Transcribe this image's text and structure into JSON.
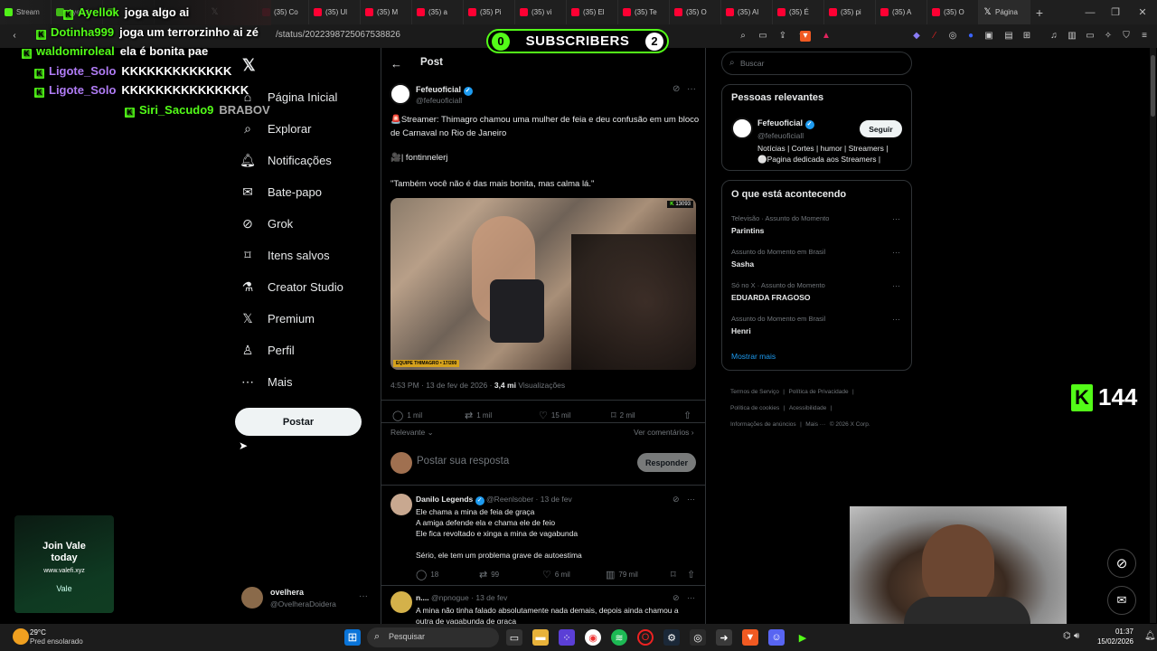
{
  "browser": {
    "tabs": [
      {
        "label": "Stream",
        "kind": "kick"
      },
      {
        "label": "Ayellok",
        "kind": "kick"
      },
      {
        "label": "",
        "kind": "kick"
      },
      {
        "label": "",
        "kind": "x"
      },
      {
        "label": "",
        "kind": "x"
      },
      {
        "label": "(35) Co",
        "kind": "yt"
      },
      {
        "label": "(35) Ul",
        "kind": "yt"
      },
      {
        "label": "(35) M",
        "kind": "yt"
      },
      {
        "label": "(35) a",
        "kind": "yt"
      },
      {
        "label": "(35) Pi",
        "kind": "yt"
      },
      {
        "label": "(35) vi",
        "kind": "yt"
      },
      {
        "label": "(35) El",
        "kind": "yt"
      },
      {
        "label": "(35) Te",
        "kind": "yt"
      },
      {
        "label": "(35) O",
        "kind": "yt"
      },
      {
        "label": "(35) Al",
        "kind": "yt"
      },
      {
        "label": "(35) É",
        "kind": "yt"
      },
      {
        "label": "(35) pi",
        "kind": "yt"
      },
      {
        "label": "(35) A",
        "kind": "yt"
      },
      {
        "label": "(35) O",
        "kind": "yt"
      },
      {
        "label": "Página",
        "kind": "x"
      }
    ],
    "url": "/status/2022398725067538826"
  },
  "subscribers": {
    "left": "0",
    "label": "SUBSCRIBERS",
    "right": "2"
  },
  "chat": [
    {
      "user": "Ayellok",
      "msg": "joga algo ai",
      "color": "#53fc18"
    },
    {
      "user": "Dotinha999",
      "msg": "joga um terrorzinho ai zé",
      "color": "#53fc18"
    },
    {
      "user": "waldomiroleal",
      "msg": "ela é bonita pae",
      "color": "#53fc18"
    },
    {
      "user": "Ligote_Solo",
      "msg": "KKKKKKKKKKKKK",
      "color": "#b07cf5"
    },
    {
      "user": "Ligote_Solo",
      "msg": "KKKKKKKKKKKKKKK",
      "color": "#b07cf5"
    },
    {
      "user": "Siri_Sacudo9",
      "msg": "BRABOV",
      "color": "#53fc18"
    }
  ],
  "nav": {
    "items": [
      {
        "label": "Página Inicial",
        "icon": "home-icon"
      },
      {
        "label": "Explorar",
        "icon": "search-icon"
      },
      {
        "label": "Notificações",
        "icon": "bell-icon"
      },
      {
        "label": "Bate-papo",
        "icon": "mail-icon"
      },
      {
        "label": "Grok",
        "icon": "grok-icon"
      },
      {
        "label": "Itens salvos",
        "icon": "bookmark-icon"
      },
      {
        "label": "Creator Studio",
        "icon": "flask-icon"
      },
      {
        "label": "Premium",
        "icon": "x-logo-icon"
      },
      {
        "label": "Perfil",
        "icon": "person-icon"
      },
      {
        "label": "Mais",
        "icon": "more-circle-icon"
      }
    ],
    "post_button": "Postar",
    "account_name": "ovelhera",
    "account_handle": "@OvelheraDoidera"
  },
  "post": {
    "header": "Post",
    "author": "Fefeuoficial",
    "handle": "@fefeuoficiall",
    "text1": "🚨Streamer: Thimagro chamou uma mulher de feia e deu confusão em um bloco de Carnaval no Rio de Janeiro",
    "text2": "🎥| fontinnelerj",
    "text3": "\"Também você não é das mais bonita, mas calma lá.\"",
    "media_badge": "13093",
    "media_caption": "EQUIPE THIMAGRO • 17/200",
    "time": "4:53 PM · 13 de fev de 2026 ·",
    "views": "3,4 mi",
    "views_label": "Visualizações",
    "replies": "1 mil",
    "reposts": "1 mil",
    "likes": "15 mil",
    "bookmarks": "2 mil",
    "sort": "Relevante",
    "see_comments": "Ver comentários",
    "reply_placeholder": "Postar sua resposta",
    "reply_button": "Responder"
  },
  "comments": [
    {
      "author": "Danilo Legends",
      "handle": "@Reenlsober",
      "date": "13 de fev",
      "lines": [
        "Ele chama a mina de feia de graça",
        "A amiga defende ela e chama ele de feio",
        "Ele fica revoltado e xinga a mina de vagabunda",
        "",
        "Sério, ele tem um problema grave de autoestima"
      ],
      "replies": "18",
      "reposts": "99",
      "likes": "6 mil",
      "views": "79 mil"
    },
    {
      "author": "n....",
      "handle": "@npnogue",
      "date": "13 de fev",
      "lines": [
        "A mina não tinha falado absolutamente nada demais, depois ainda chamou a outra de vagabunda de graça"
      ]
    }
  ],
  "right": {
    "search_placeholder": "Buscar",
    "relevant": {
      "title": "Pessoas relevantes",
      "name": "Fefeuoficial",
      "handle": "@fefeuoficiall",
      "follow": "Seguir",
      "bio1": "Notícias | Cortes | humor | Streamers |",
      "bio2": "⚪Pagina dedicada aos Streamers |"
    },
    "trends_title": "O que está acontecendo",
    "trends": [
      {
        "category": "Televisão · Assunto do Momento",
        "name": "Parintins"
      },
      {
        "category": "Assunto do Momento em Brasil",
        "name": "Sasha"
      },
      {
        "category": "Só no X · Assunto do Momento",
        "name": "EDUARDA FRAGOSO"
      },
      {
        "category": "Assunto do Momento em Brasil",
        "name": "Henri"
      }
    ],
    "show_more": "Mostrar mais",
    "footer": [
      "Termos de Serviço",
      "Política de Privacidade",
      "Política de cookies",
      "Acessibilidade",
      "Informações de anúncios",
      "Mais ···",
      "© 2026 X Corp."
    ]
  },
  "overlay": {
    "kick_count": "144",
    "join_title": "Join Vale",
    "join_sub": "today",
    "join_url": "www.valefi.xyz",
    "join_brand": "Vale"
  },
  "taskbar": {
    "temp": "29°C",
    "weather": "Pred ensolarado",
    "search": "Pesquisar",
    "time": "01:37",
    "date": "15/02/2026"
  }
}
